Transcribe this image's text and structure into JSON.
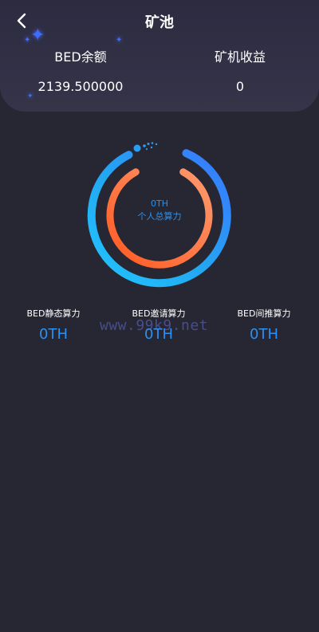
{
  "header": {
    "title": "矿池",
    "back_icon": "chevron-left-icon"
  },
  "stats": {
    "balance_label": "BED余额",
    "balance_value": "2139.500000",
    "mining_income_label": "矿机收益",
    "mining_income_value": "0"
  },
  "gauge": {
    "value": "0TH",
    "label": "个人总算力",
    "outer_color": "#2aa9f5",
    "inner_color": "#ff6a3a"
  },
  "metrics": [
    {
      "label": "BED静态算力",
      "value": "0TH"
    },
    {
      "label": "BED邀请算力",
      "value": "0TH"
    },
    {
      "label": "BED间推算力",
      "value": "0TH"
    }
  ],
  "watermark": "www.99k9.net",
  "colors": {
    "background": "#272733",
    "header_card": "#32314a",
    "accent_blue": "#2d8ff0"
  }
}
